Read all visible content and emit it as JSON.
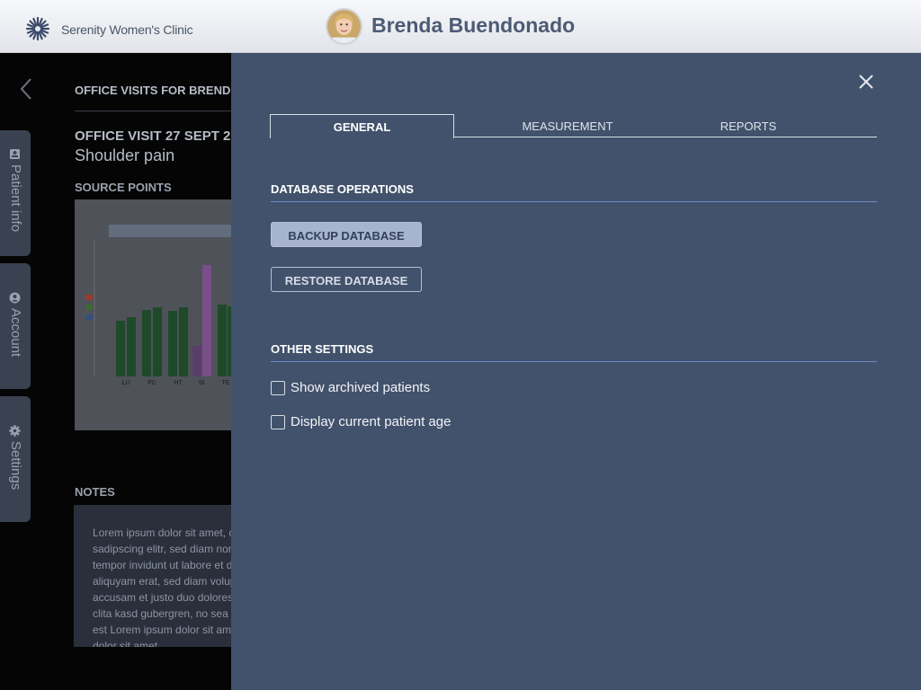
{
  "header": {
    "clinic_name": "Serenity Women's Clinic",
    "patient_name": "Brenda Buendonado"
  },
  "background": {
    "visits_heading": "OFFICE VISITS FOR BREND",
    "visit_title": "OFFICE VISIT 27 SEPT 2",
    "visit_complaint": "Shoulder pain",
    "source_points_heading": "SOURCE POINTS",
    "notes_heading": "NOTES",
    "notes_text": "Lorem ipsum dolor sit amet, consetetur sadipscing elitr, sed diam nonumy eirmod tempor invidunt ut labore et dolore magna aliquyam erat, sed diam voluptua. At vero eos et accusam et justo duo dolores et ea rebum. Stet clita kasd gubergren, no sea takimata sanctus est Lorem ipsum dolor sit amet. Lorem ipsum dolor sit amet.",
    "chart_thumbnail": {
      "categories": [
        "LU",
        "PC",
        "HT",
        "SI",
        "TE"
      ]
    }
  },
  "side_tabs": [
    {
      "label": "Patient info",
      "icon": "id-card-icon"
    },
    {
      "label": "Account",
      "icon": "user-circle-icon"
    },
    {
      "label": "Settings",
      "icon": "gear-icon"
    }
  ],
  "settings_panel": {
    "tabs": [
      {
        "label": "GENERAL",
        "active": true
      },
      {
        "label": "MEASUREMENT",
        "active": false
      },
      {
        "label": "REPORTS",
        "active": false
      }
    ],
    "database_section_title": "DATABASE OPERATIONS",
    "backup_button": "BACKUP DATABASE",
    "restore_button": "RESTORE DATABASE",
    "other_section_title": "OTHER SETTINGS",
    "options": [
      {
        "label": "Show archived patients",
        "checked": false
      },
      {
        "label": "Display current patient age",
        "checked": false
      }
    ]
  },
  "colors": {
    "panel_bg": "#42526c",
    "accent_line": "#6f86c9",
    "primary_button": "#a7b4cf"
  }
}
